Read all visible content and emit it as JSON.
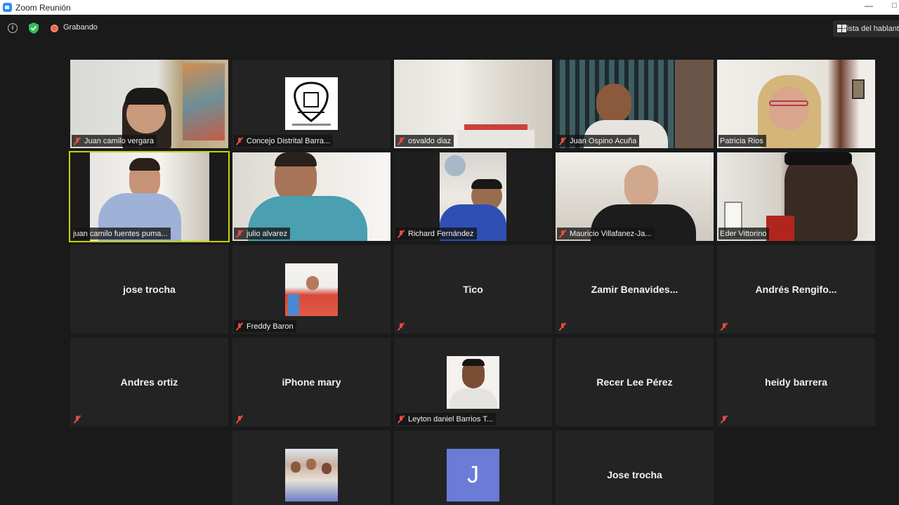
{
  "window": {
    "title": "Zoom Reunión"
  },
  "toolbar": {
    "recording_label": "Grabando",
    "view_label": "Vista del hablante"
  },
  "tiles": [
    {
      "name": "Juan camilo vergara"
    },
    {
      "name": "Concejo Distrital Barra..."
    },
    {
      "name": "osvaldo diaz"
    },
    {
      "name": "Juan Ospino Acuña"
    },
    {
      "name": "Patricia Rios"
    },
    {
      "name": "juan camilo fuentes puma..."
    },
    {
      "name": "julio alvarez"
    },
    {
      "name": "Richard Fernández"
    },
    {
      "name": "Mauricio Villafanez-Ja..."
    },
    {
      "name": "Eder Vittorino"
    },
    {
      "name": "jose trocha"
    },
    {
      "name": "Freddy Baron"
    },
    {
      "name": "Tico"
    },
    {
      "name": "Zamir  Benavides..."
    },
    {
      "name": "Andrés  Rengifo..."
    },
    {
      "name": "Andres ortiz"
    },
    {
      "name": "iPhone mary"
    },
    {
      "name": "Leyton daniel Barrios T..."
    },
    {
      "name": "Recer Lee Pérez"
    },
    {
      "name": "heidy barrera"
    },
    {
      "name": ""
    },
    {
      "name": "J"
    },
    {
      "name": "Jose trocha"
    }
  ],
  "colors": {
    "active_speaker_border": "#c6d300",
    "avatar_tile": "#6b7bd6",
    "recording": "#e8664d",
    "mic_muted": "#e74c3c"
  }
}
